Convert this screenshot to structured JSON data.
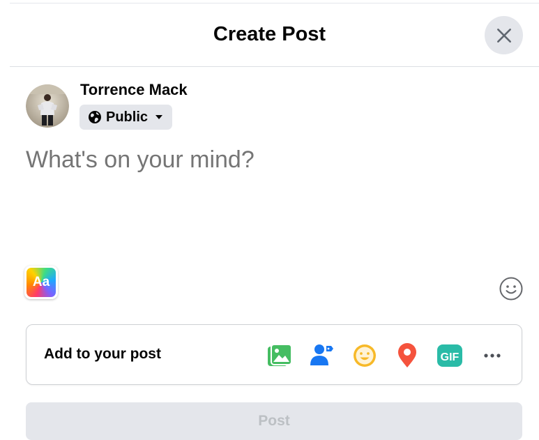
{
  "header": {
    "title": "Create Post",
    "close_icon": "close-icon"
  },
  "user": {
    "name": "Torrence Mack",
    "avatar_icon": "user-avatar",
    "audience_label": "Public",
    "audience_icon": "globe-icon"
  },
  "composer": {
    "placeholder": "What's on your mind?"
  },
  "text_format_button": {
    "label": "Aa"
  },
  "emoji_button": {
    "icon": "smiley-icon"
  },
  "add_to_post": {
    "label": "Add to your post",
    "tools": [
      {
        "name": "photo-video",
        "icon": "photo-icon",
        "color": "#45bd62"
      },
      {
        "name": "tag-people",
        "icon": "tag-people-icon",
        "color": "#1877f2"
      },
      {
        "name": "feeling-activity",
        "icon": "feeling-icon",
        "color": "#f7b928"
      },
      {
        "name": "check-in",
        "icon": "location-pin-icon",
        "color": "#f5533d"
      },
      {
        "name": "gif",
        "icon": "gif-icon",
        "label": "GIF",
        "color": "#2abba7"
      },
      {
        "name": "more",
        "icon": "more-icon",
        "color": "#65676b"
      }
    ]
  },
  "post_button": {
    "label": "Post",
    "enabled": false
  }
}
